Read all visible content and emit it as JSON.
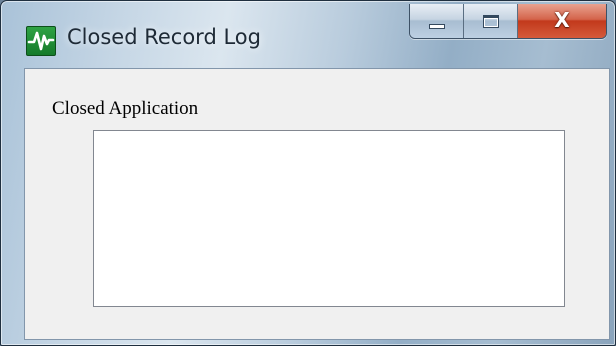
{
  "window": {
    "title": "Closed Record Log",
    "icon": "green-waveform-icon",
    "controls": {
      "minimize_icon": "minimize-icon",
      "maximize_icon": "maximize-icon",
      "close_label": "X"
    }
  },
  "content": {
    "group_label": "Closed Application",
    "list_items": []
  },
  "colors": {
    "icon_green": "#1f8f35",
    "close_red": "#c2391c",
    "client_bg": "#f0f0f0",
    "list_bg": "#ffffff"
  }
}
